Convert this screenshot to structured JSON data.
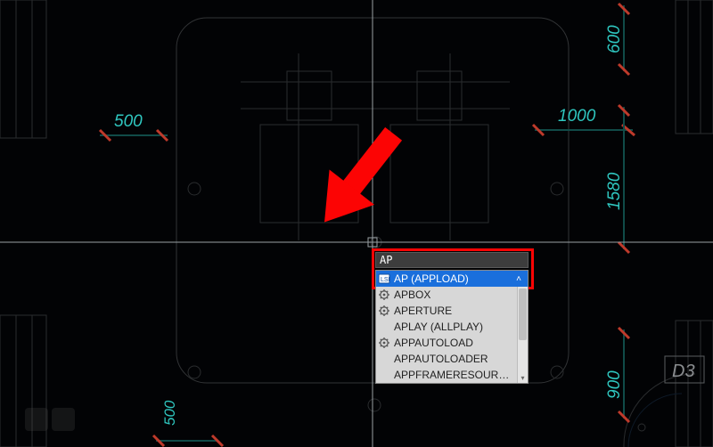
{
  "command": {
    "input_value": "AP",
    "placeholder": ""
  },
  "autocomplete": {
    "items": [
      {
        "label": "AP (APPLOAD)",
        "icon": "lisp-icon",
        "selected": true,
        "expand": "collapse"
      },
      {
        "label": "APBOX",
        "icon": "gear-icon",
        "selected": false
      },
      {
        "label": "APERTURE",
        "icon": "gear-icon",
        "selected": false
      },
      {
        "label": "APLAY (ALLPLAY)",
        "icon": "",
        "selected": false
      },
      {
        "label": "APPAUTOLOAD",
        "icon": "gear-icon",
        "selected": false
      },
      {
        "label": "APPAUTOLOADER",
        "icon": "",
        "selected": false
      },
      {
        "label": "APPFRAMERESOURCES",
        "icon": "",
        "selected": false,
        "expand": "expand"
      }
    ]
  },
  "dimensions": {
    "top_left": "500",
    "top_right": "1000",
    "right_top": "600",
    "right_mid": "1580",
    "right_bottom": "900",
    "bottom": "500"
  },
  "grid_ref": "D3",
  "colors": {
    "accent_teal": "#2fc7c0",
    "tick_red": "#bf3a2b",
    "highlight_red": "#fc0404",
    "autocomplete_sel": "#1a6fdc"
  }
}
